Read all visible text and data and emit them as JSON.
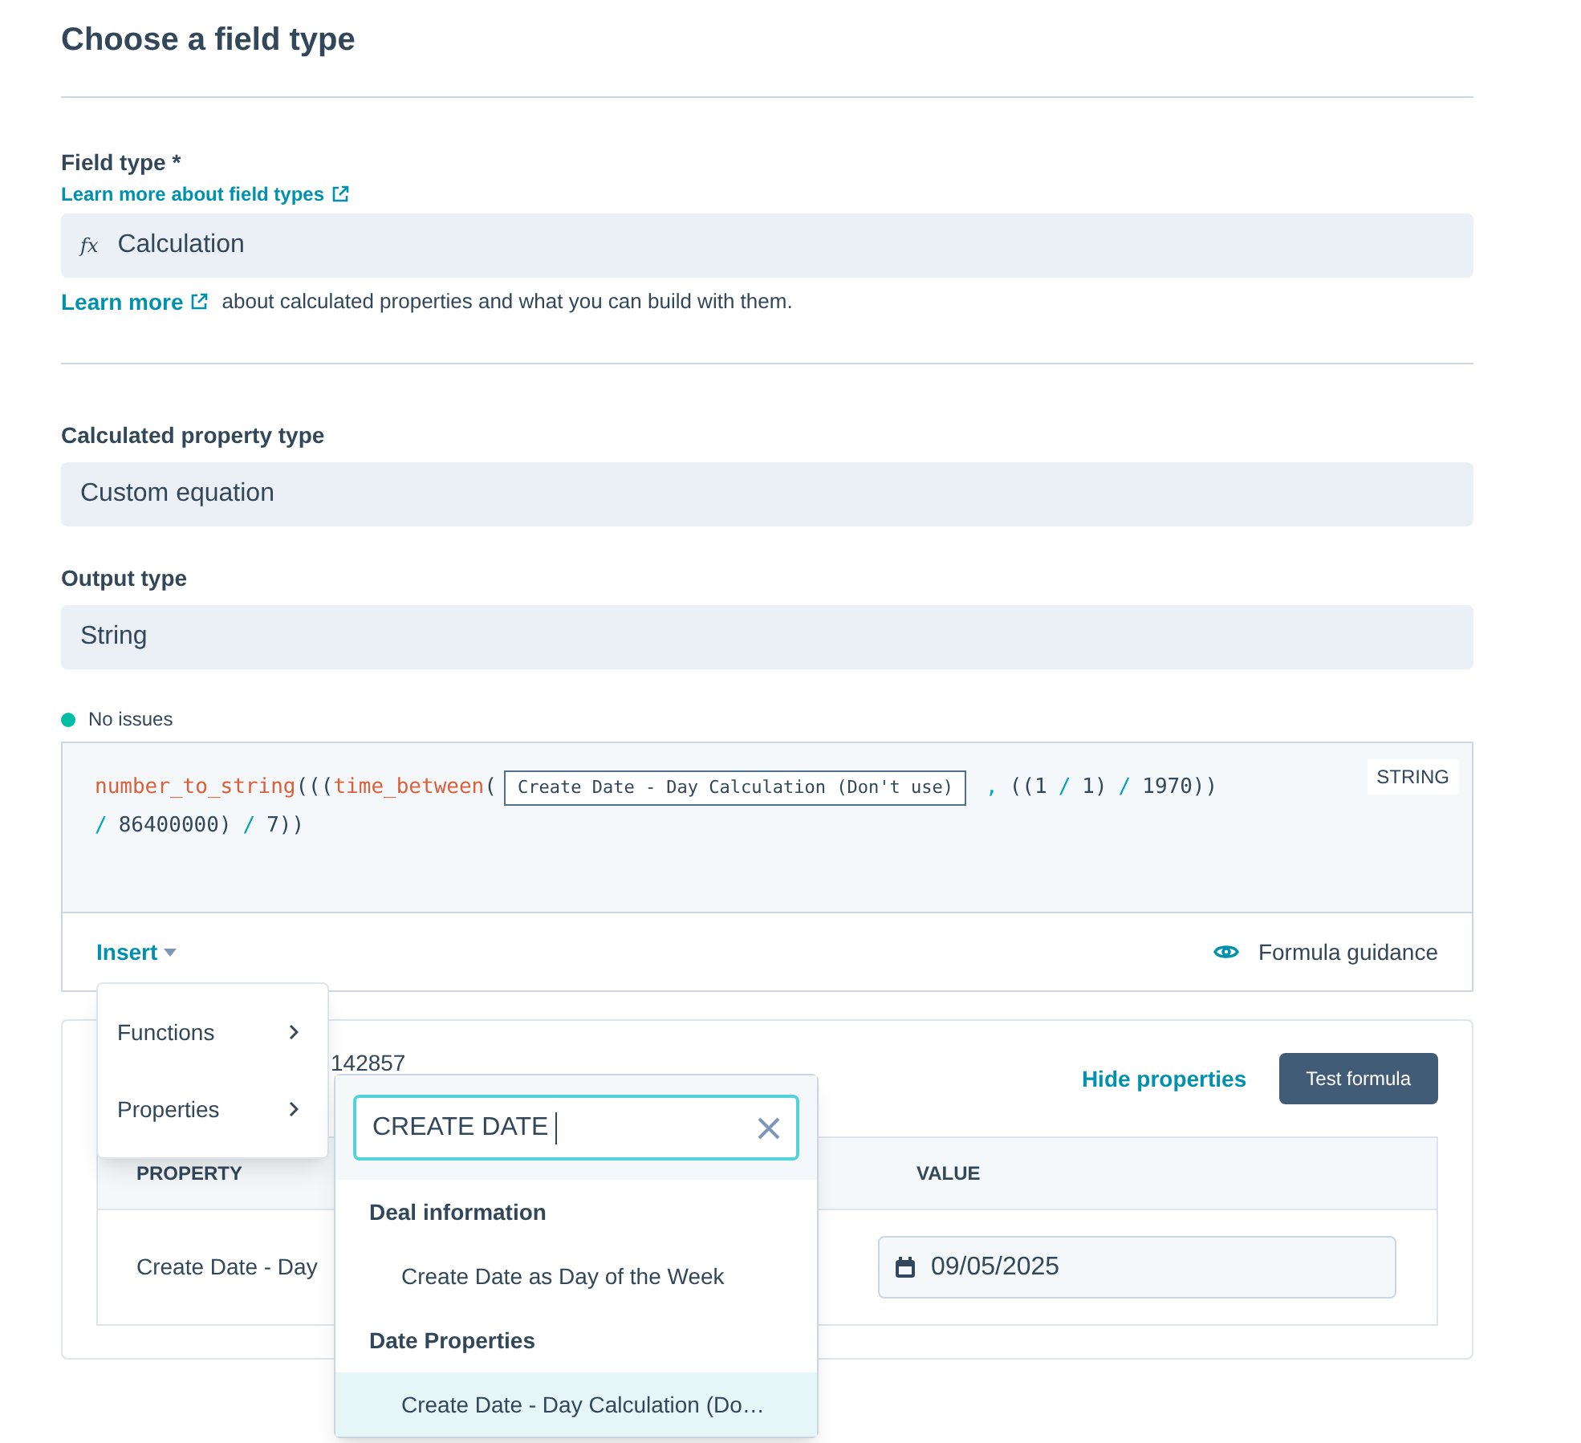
{
  "title": "Choose a field type",
  "field_type": {
    "label": "Field type *",
    "help_link": "Learn more about field types",
    "value": "Calculation",
    "icon_text": "fx",
    "learn_more": "Learn more",
    "learn_more_rest": "about calculated properties and what you can build with them."
  },
  "calculated_property_type": {
    "label": "Calculated property type",
    "value": "Custom equation"
  },
  "output_type": {
    "label": "Output type",
    "value": "String"
  },
  "status": {
    "text": "No issues",
    "color": "#00bda5"
  },
  "formula": {
    "badge": "STRING",
    "lines": [
      [
        {
          "kind": "func",
          "text": "number_to_string"
        },
        {
          "kind": "plain",
          "text": "((("
        },
        {
          "kind": "func",
          "text": "time_between"
        },
        {
          "kind": "plain",
          "text": "("
        },
        {
          "kind": "property",
          "text": "Create Date - Day Calculation (Don't use)"
        },
        {
          "kind": "op",
          "text": ","
        },
        {
          "kind": "plain",
          "text": "((1"
        },
        {
          "kind": "op",
          "text": "/"
        },
        {
          "kind": "plain",
          "text": "1)"
        },
        {
          "kind": "op",
          "text": "/"
        },
        {
          "kind": "plain",
          "text": "1970))"
        }
      ],
      [
        {
          "kind": "op",
          "text": "/"
        },
        {
          "kind": "plain",
          "text": "86400000)"
        },
        {
          "kind": "op",
          "text": "/"
        },
        {
          "kind": "plain",
          "text": "7))"
        }
      ]
    ]
  },
  "toolbar": {
    "insert": "Insert",
    "guidance": "Formula guidance"
  },
  "test": {
    "result": "142857",
    "hide": "Hide properties",
    "button": "Test formula",
    "columns": [
      "PROPERTY",
      "VALUE"
    ],
    "row": {
      "property": "Create Date - Day",
      "value": "09/05/2025"
    }
  },
  "insert_menu": [
    {
      "label": "Functions"
    },
    {
      "label": "Properties"
    }
  ],
  "property_picker": {
    "search": "CREATE DATE ",
    "groups": [
      {
        "heading": "Deal information",
        "items": [
          {
            "label": "Create Date as Day of the Week",
            "selected": false
          }
        ]
      },
      {
        "heading": "Date Properties",
        "items": [
          {
            "label": "Create Date - Day Calculation (Do…",
            "selected": true
          }
        ]
      }
    ]
  }
}
